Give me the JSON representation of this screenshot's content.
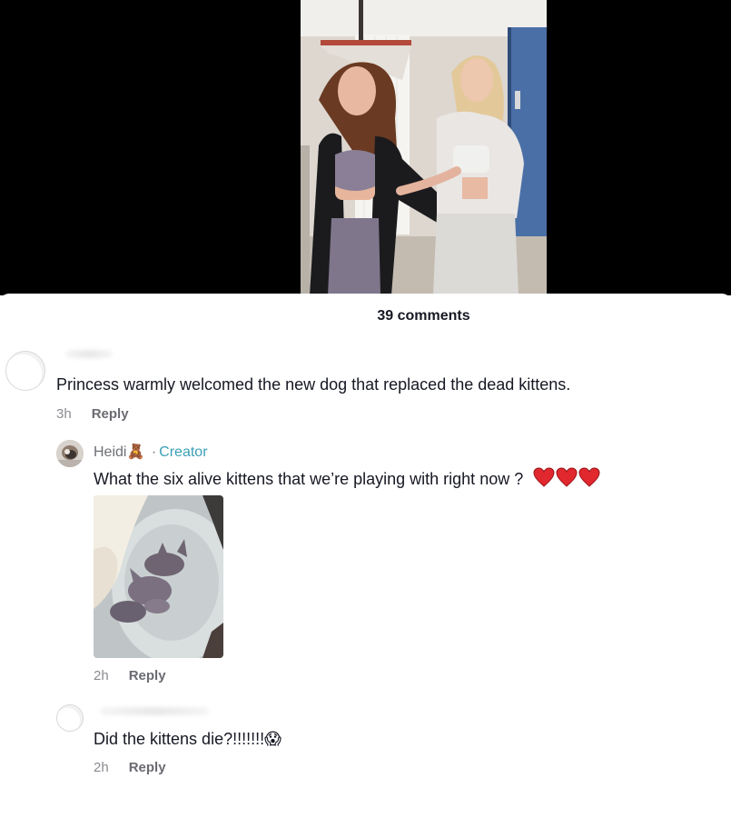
{
  "comments_header": {
    "count_label": "39 comments"
  },
  "comments": [
    {
      "text": "Princess warmly welcomed the new dog that replaced the dead kittens.",
      "time": "3h",
      "reply_label": "Reply"
    },
    {
      "author": "Heidi",
      "author_emoji": "🧸",
      "separator": "·",
      "badge": "Creator",
      "text": "What the six alive kittens that we’re playing with right now ?",
      "hearts": "❤️❤️❤️",
      "has_photo": true,
      "time": "2h",
      "reply_label": "Reply"
    },
    {
      "text": "Did the kittens die?!!!!!!!",
      "emoji": "😱",
      "time": "2h",
      "reply_label": "Reply"
    }
  ],
  "colors": {
    "background": "#ffffff",
    "video_background": "#000000",
    "text": "#161823",
    "muted": "#8a8b91",
    "creator_badge": "#3aa0b5",
    "heart": "#e0282e"
  },
  "icons": [
    "teddy-bear-emoji",
    "red-heart-icon",
    "screaming-face-emoji"
  ]
}
